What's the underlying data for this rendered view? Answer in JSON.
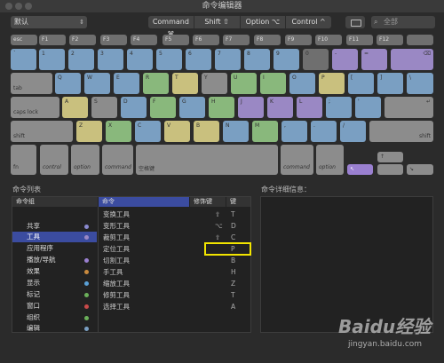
{
  "window": {
    "title": "命令编辑器"
  },
  "toolbar": {
    "preset": "默认",
    "modifiers": [
      "Command ⌘",
      "Shift ⇧",
      "Option ⌥",
      "Control ^"
    ],
    "search_placeholder": "全部"
  },
  "keyboard": {
    "row_fn": [
      "esc",
      "F1",
      "F2",
      "F3",
      "F4",
      "F5",
      "F6",
      "F7",
      "F8",
      "F9",
      "F10",
      "F11",
      "F12"
    ],
    "row_num": [
      "`",
      "1",
      "2",
      "3",
      "4",
      "5",
      "6",
      "7",
      "8",
      "9",
      "0",
      "-",
      "=",
      "⌫"
    ],
    "row_q": [
      "tab",
      "Q",
      "W",
      "E",
      "R",
      "T",
      "Y",
      "U",
      "I",
      "O",
      "P",
      "[",
      "]",
      "\\"
    ],
    "row_a": [
      "caps lock",
      "A",
      "S",
      "D",
      "F",
      "G",
      "H",
      "J",
      "K",
      "L",
      ";",
      "'",
      "↵"
    ],
    "row_z": [
      "shift",
      "Z",
      "X",
      "C",
      "V",
      "B",
      "N",
      "M",
      ",",
      ".",
      "/",
      "shift"
    ],
    "row_bottom": [
      "fn",
      "control",
      "option",
      "command",
      "空格键",
      "command",
      "option"
    ],
    "arrows": [
      "↖",
      "↑",
      "↘"
    ]
  },
  "command_list": {
    "title": "命令列表",
    "groups_header": "命令组",
    "cmd_header": "命令",
    "mod_header": "修饰键",
    "key_header": "键",
    "groups": [
      {
        "label": "共享",
        "color": "#8a8ad0"
      },
      {
        "label": "工具",
        "color": "#9a88c4",
        "selected": true
      },
      {
        "label": "应用程序",
        "color": ""
      },
      {
        "label": "播放/导航",
        "color": "#9a80d0"
      },
      {
        "label": "效果",
        "color": "#c98a3e"
      },
      {
        "label": "显示",
        "color": "#5aa0d6"
      },
      {
        "label": "标记",
        "color": "#6bb05a"
      },
      {
        "label": "窗口",
        "color": "#c94a4a"
      },
      {
        "label": "组织",
        "color": "#6bb05a"
      },
      {
        "label": "编辑",
        "color": "#7a9fc2"
      }
    ],
    "commands": [
      {
        "name": "变换工具",
        "mod": "⇧",
        "key": "T"
      },
      {
        "name": "变形工具",
        "mod": "⌥",
        "key": "D"
      },
      {
        "name": "裁剪工具",
        "mod": "⇧",
        "key": "C"
      },
      {
        "name": "定位工具",
        "mod": "",
        "key": "P"
      },
      {
        "name": "切割工具",
        "mod": "",
        "key": "B"
      },
      {
        "name": "手工具",
        "mod": "",
        "key": "H"
      },
      {
        "name": "缩放工具",
        "mod": "",
        "key": "Z"
      },
      {
        "name": "修剪工具",
        "mod": "",
        "key": "T"
      },
      {
        "name": "选择工具",
        "mod": "",
        "key": "A"
      }
    ]
  },
  "detail": {
    "title": "命令详细信息："
  },
  "watermark": {
    "brand": "Baidu经验",
    "url": "jingyan.baidu.com"
  }
}
